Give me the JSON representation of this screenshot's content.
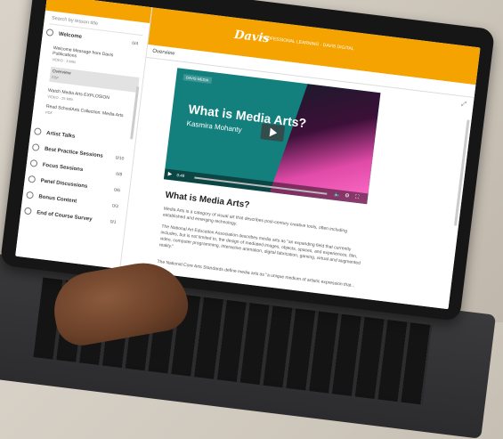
{
  "app": {
    "logo": "Davis",
    "brand_subtitle": "PROFESSIONAL LEARNING · DAVIS DIGITAL"
  },
  "sidebar": {
    "search_placeholder": "Search by lesson title",
    "sections": [
      {
        "title": "Welcome",
        "count": "0/4"
      },
      {
        "title": "Artist Talks",
        "count": ""
      },
      {
        "title": "Best Practice Sessions",
        "count": "0/10"
      },
      {
        "title": "Focus Sessions",
        "count": "0/8"
      },
      {
        "title": "Panel Discussions",
        "count": "0/6"
      },
      {
        "title": "Bonus Content",
        "count": "0/3"
      },
      {
        "title": "End of Course Survey",
        "count": "0/1"
      }
    ],
    "lessons": [
      {
        "title": "Welcome Message from Davis Publications",
        "meta": "VIDEO · 3 MIN"
      },
      {
        "title": "Overview",
        "meta": "PDF"
      },
      {
        "title": "Watch Media Arts EXPLOSION",
        "meta": "VIDEO · 25 MIN"
      },
      {
        "title": "Read SchoolArts Collection: Media Arts",
        "meta": "PDF"
      }
    ]
  },
  "content": {
    "tab": "Overview",
    "video": {
      "badge": "DAVIS MEDIA",
      "title": "What is Media Arts?",
      "speaker": "Kasmira Mohanty",
      "time": "0:49"
    },
    "heading": "What is Media Arts?",
    "paragraphs": [
      "Media Arts is a category of visual art that describes post-century creative tools, often including established and emerging technology.",
      "The National Art Education Association describes media arts as \"an expanding field that currently includes, but is not limited to, the design of mediated images, objects, spaces, and experiences, film, video, computer programming, interactive animation, digital fabrication, gaming, virtual and augmented reality.\"",
      "The National Core Arts Standards define media arts as \"a unique medium of artistic expression that..."
    ]
  },
  "icons": {
    "play": "play-icon",
    "volume": "volume-icon",
    "settings": "gear-icon",
    "fullscreen": "fullscreen-icon"
  },
  "colors": {
    "accent": "#f5a300",
    "video_bg": "#14807e"
  }
}
